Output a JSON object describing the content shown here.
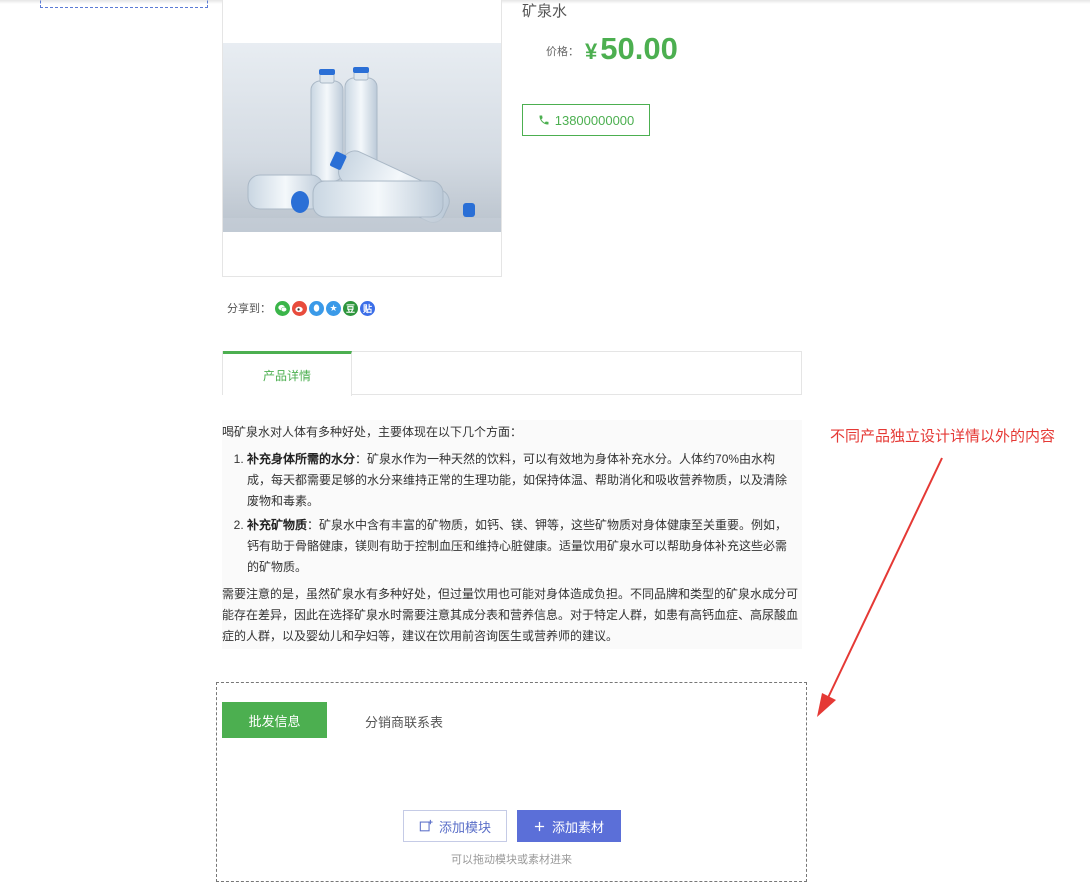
{
  "product": {
    "name": "矿泉水",
    "price_label": "价格：",
    "currency": "¥",
    "price": "50.00",
    "phone": "13800000000",
    "accent_color": "#4caf50"
  },
  "share": {
    "label": "分享到：",
    "icons": [
      {
        "name": "wechat-icon",
        "glyph": "",
        "color": "#3bb54a"
      },
      {
        "name": "weibo-icon",
        "glyph": "",
        "color": "#e84c3d"
      },
      {
        "name": "qq-icon",
        "glyph": "",
        "color": "#3b9ae8"
      },
      {
        "name": "qzone-icon",
        "glyph": "★",
        "color": "#3b9ae8"
      },
      {
        "name": "douban-icon",
        "glyph": "豆",
        "color": "#2e963d"
      },
      {
        "name": "tieba-icon",
        "glyph": "贴",
        "color": "#3b6ee8"
      }
    ]
  },
  "tabs": {
    "details_label": "产品详情"
  },
  "details": {
    "intro": "喝矿泉水对人体有多种好处，主要体现在以下几个方面：",
    "points": [
      {
        "title": "补充身体所需的水分",
        "text": "：矿泉水作为一种天然的饮料，可以有效地为身体补充水分。人体约70%由水构成，每天都需要足够的水分来维持正常的生理功能，如保持体温、帮助消化和吸收营养物质，以及清除废物和毒素。"
      },
      {
        "title": "补充矿物质",
        "text": "：矿泉水中含有丰富的矿物质，如钙、镁、钾等，这些矿物质对身体健康至关重要。例如，钙有助于骨骼健康，镁则有助于控制血压和维持心脏健康。适量饮用矿泉水可以帮助身体补充这些必需的矿物质。"
      }
    ],
    "note": "需要注意的是，虽然矿泉水有多种好处，但过量饮用也可能对身体造成负担。不同品牌和类型的矿泉水成分可能存在差异，因此在选择矿泉水时需要注意其成分表和营养信息。对于特定人群，如患有高钙血症、高尿酸血症的人群，以及婴幼儿和孕妇等，建议在饮用前咨询医生或营养师的建议。"
  },
  "annotation": {
    "text": "不同产品独立设计详情以外的内容",
    "color": "#e53935"
  },
  "wholesale": {
    "tab_wholesale": "批发信息",
    "tab_distributor": "分销商联系表",
    "add_module": "添加模块",
    "add_material": "添加素材",
    "drag_hint": "可以拖动模块或素材进来"
  }
}
